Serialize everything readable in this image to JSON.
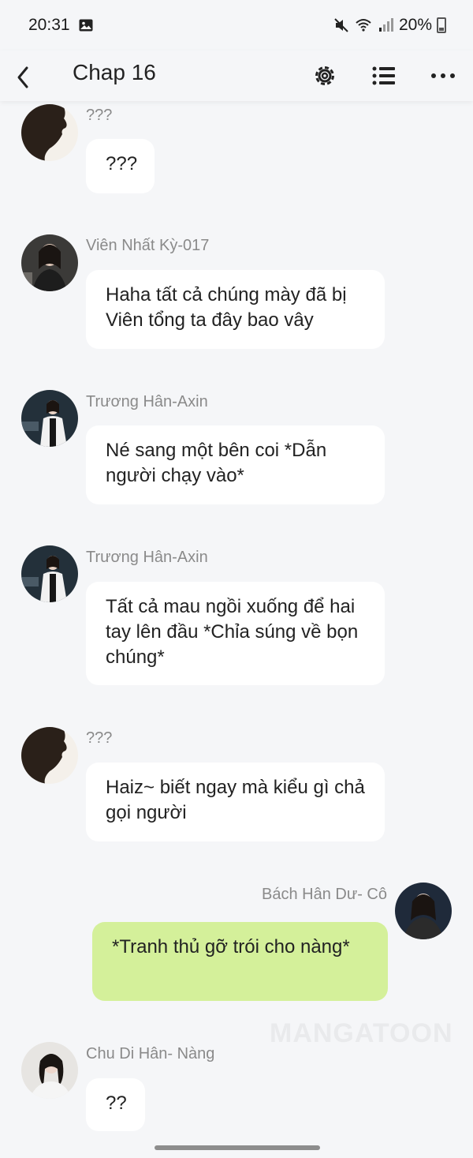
{
  "status_bar": {
    "time": "20:31",
    "battery": "20%"
  },
  "header": {
    "title": "Chap 16"
  },
  "messages": [
    {
      "sender": "???",
      "text": "???"
    },
    {
      "sender": "Viên Nhất Kỳ-017",
      "text": "Haha tất cả chúng mày đã bị Viên tổng ta đây bao vây"
    },
    {
      "sender": "Trương Hân-Axin",
      "text": "Né sang một bên coi *Dẫn người chạy vào*"
    },
    {
      "sender": "Trương Hân-Axin",
      "text": "Tất cả mau ngồi xuống để hai tay lên đầu *Chỉa súng về bọn chúng*"
    },
    {
      "sender": "???",
      "text": "Haiz~ biết ngay mà kiểu gì chả gọi người"
    },
    {
      "sender": "Bách Hân Dư- Cô",
      "text": "*Tranh thủ gỡ trói cho nàng*",
      "side": "right"
    },
    {
      "sender": "Chu Di Hân- Nàng",
      "text": "??"
    }
  ],
  "watermark": "MANGATOON",
  "colors": {
    "background": "#f5f6f8",
    "bubble": "#ffffff",
    "own_bubble": "#d4f09a",
    "sender_name": "#8a8a8a"
  }
}
